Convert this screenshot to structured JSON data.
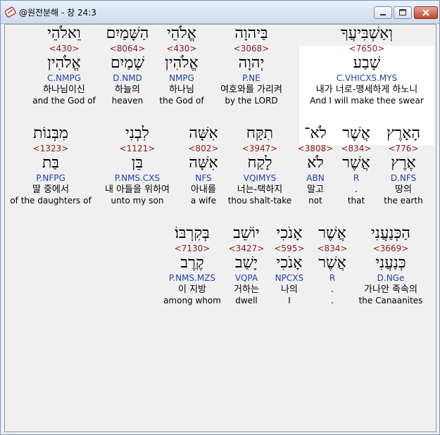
{
  "window": {
    "title": "@원전분해 - 창 24:3"
  },
  "rows": [
    {
      "words": [
        {
          "heb": "וְאַשְׁבִּיעֲךָ",
          "strong": "<7650>",
          "root": "שָׁבַע",
          "parse": "C.VHICXS.MYS",
          "kor": "내가 너로-맹세하게 하노니",
          "eng": "And I will make thee swear",
          "highlight": true
        },
        {
          "heb": "בַּיהוָה",
          "strong": "<3068>",
          "root": "יְהוָה",
          "parse": "P.NE",
          "kor": "여호와를 가리켜",
          "eng": "by the LORD"
        },
        {
          "heb": "אֱלֹהֵי",
          "strong": "<430>",
          "root": "אֱלֹהִין",
          "parse": "NMPG",
          "kor": "하나님",
          "eng": "the God of"
        },
        {
          "heb": "הַשָּׁמַיִם",
          "strong": "<8064>",
          "root": "שָׁמַיִם",
          "parse": "D.NMD",
          "kor": "하늘의",
          "eng": "heaven"
        },
        {
          "heb": "וֵאלֹהֵי",
          "strong": "<430>",
          "root": "אֱלֹהִין",
          "parse": "C.NMPG",
          "kor": "하나님이신",
          "eng": "and the God of"
        }
      ]
    },
    {
      "words": [
        {
          "heb": "הָאָרֶץ",
          "strong": "<776>",
          "root": "אֶרֶץ",
          "parse": "D.NFS",
          "kor": "땅의",
          "eng": "the earth"
        },
        {
          "heb": "אֲשֶׁר",
          "strong": "<834>",
          "root": "אֲשֶׁר",
          "parse": "R",
          "kor": ".",
          "eng": "that"
        },
        {
          "heb": "לֹא־",
          "strong": "<3808>",
          "root": "לֹא",
          "parse": "ABN",
          "kor": "말고",
          "eng": "not"
        },
        {
          "heb": "תִקַּח",
          "strong": "<3947>",
          "root": "לָקַח",
          "parse": "VQIMYS",
          "kor": "너는-택하지",
          "eng": "thou shalt-take"
        },
        {
          "heb": "אִשָּׁה",
          "strong": "<802>",
          "root": "אִשָּׁה",
          "parse": "NFS",
          "kor": "아내를",
          "eng": "a wife"
        },
        {
          "heb": "לִבְנִי",
          "strong": "<1121>",
          "root": "בֵּן",
          "parse": "P.NMS.CXS",
          "kor": "내 아들을 위하여",
          "eng": "unto my son"
        },
        {
          "heb": "מִבְּנוֹת",
          "strong": "<1323>",
          "root": "בַּת",
          "parse": "P.NFPG",
          "kor": "딸 중에서",
          "eng": "of the daughters of"
        }
      ]
    },
    {
      "words": [
        {
          "heb": "הַכְּנַעֲנִי",
          "strong": "<3669>",
          "root": "כְּנַעֲנִי",
          "parse": "D.NGe",
          "kor": "가나안 족속의",
          "eng": "the Canaanites"
        },
        {
          "heb": "אֲשֶׁר",
          "strong": "<834>",
          "root": "אֲשֶׁר",
          "parse": "R",
          "kor": ".",
          "eng": "."
        },
        {
          "heb": "אָנֹכִי",
          "strong": "<595>",
          "root": "אָנֹכִי",
          "parse": "NPCXS",
          "kor": "나의",
          "eng": "I"
        },
        {
          "heb": "יוֹשֵׁב",
          "strong": "<3427>",
          "root": "יָשַׁב",
          "parse": "VQPA",
          "kor": "거하는",
          "eng": "dwell"
        },
        {
          "heb": "בְּקִרְבּוֹ׃",
          "strong": "<7130>",
          "root": "קֶרֶב",
          "parse": "P.NMS.MZS",
          "kor": "이 지방",
          "eng": "among whom"
        }
      ]
    }
  ]
}
